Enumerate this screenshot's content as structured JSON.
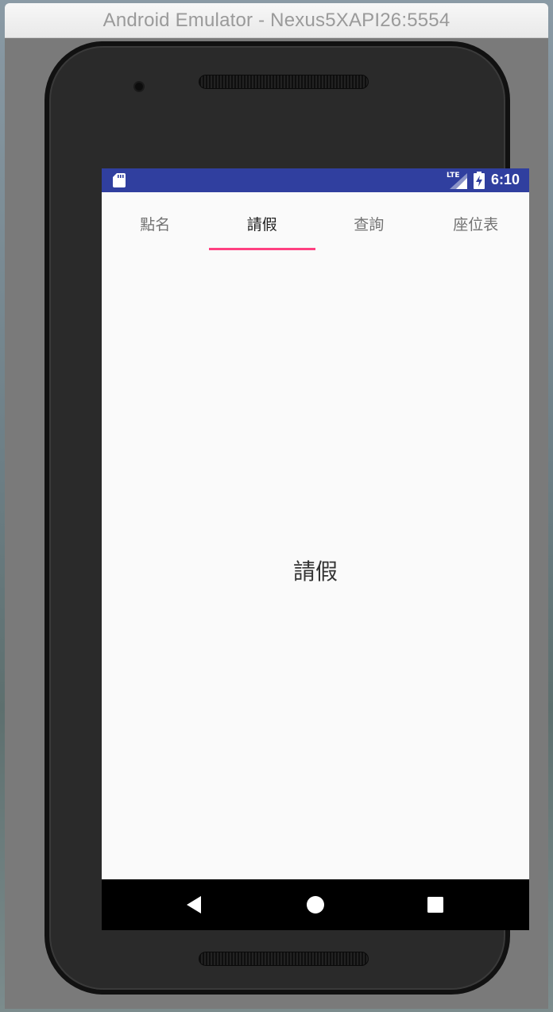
{
  "window": {
    "title": "Android Emulator - Nexus5XAPI26:5554"
  },
  "statusbar": {
    "network": "LTE",
    "time": "6:10",
    "color": "#303f9f"
  },
  "tabs": [
    {
      "label": "點名",
      "active": false
    },
    {
      "label": "請假",
      "active": true
    },
    {
      "label": "查詢",
      "active": false
    },
    {
      "label": "座位表",
      "active": false
    }
  ],
  "accent_color": "#ff4081",
  "content": {
    "label": "請假"
  },
  "navbar": {
    "buttons": [
      "back-icon",
      "home-icon",
      "recents-icon"
    ]
  }
}
